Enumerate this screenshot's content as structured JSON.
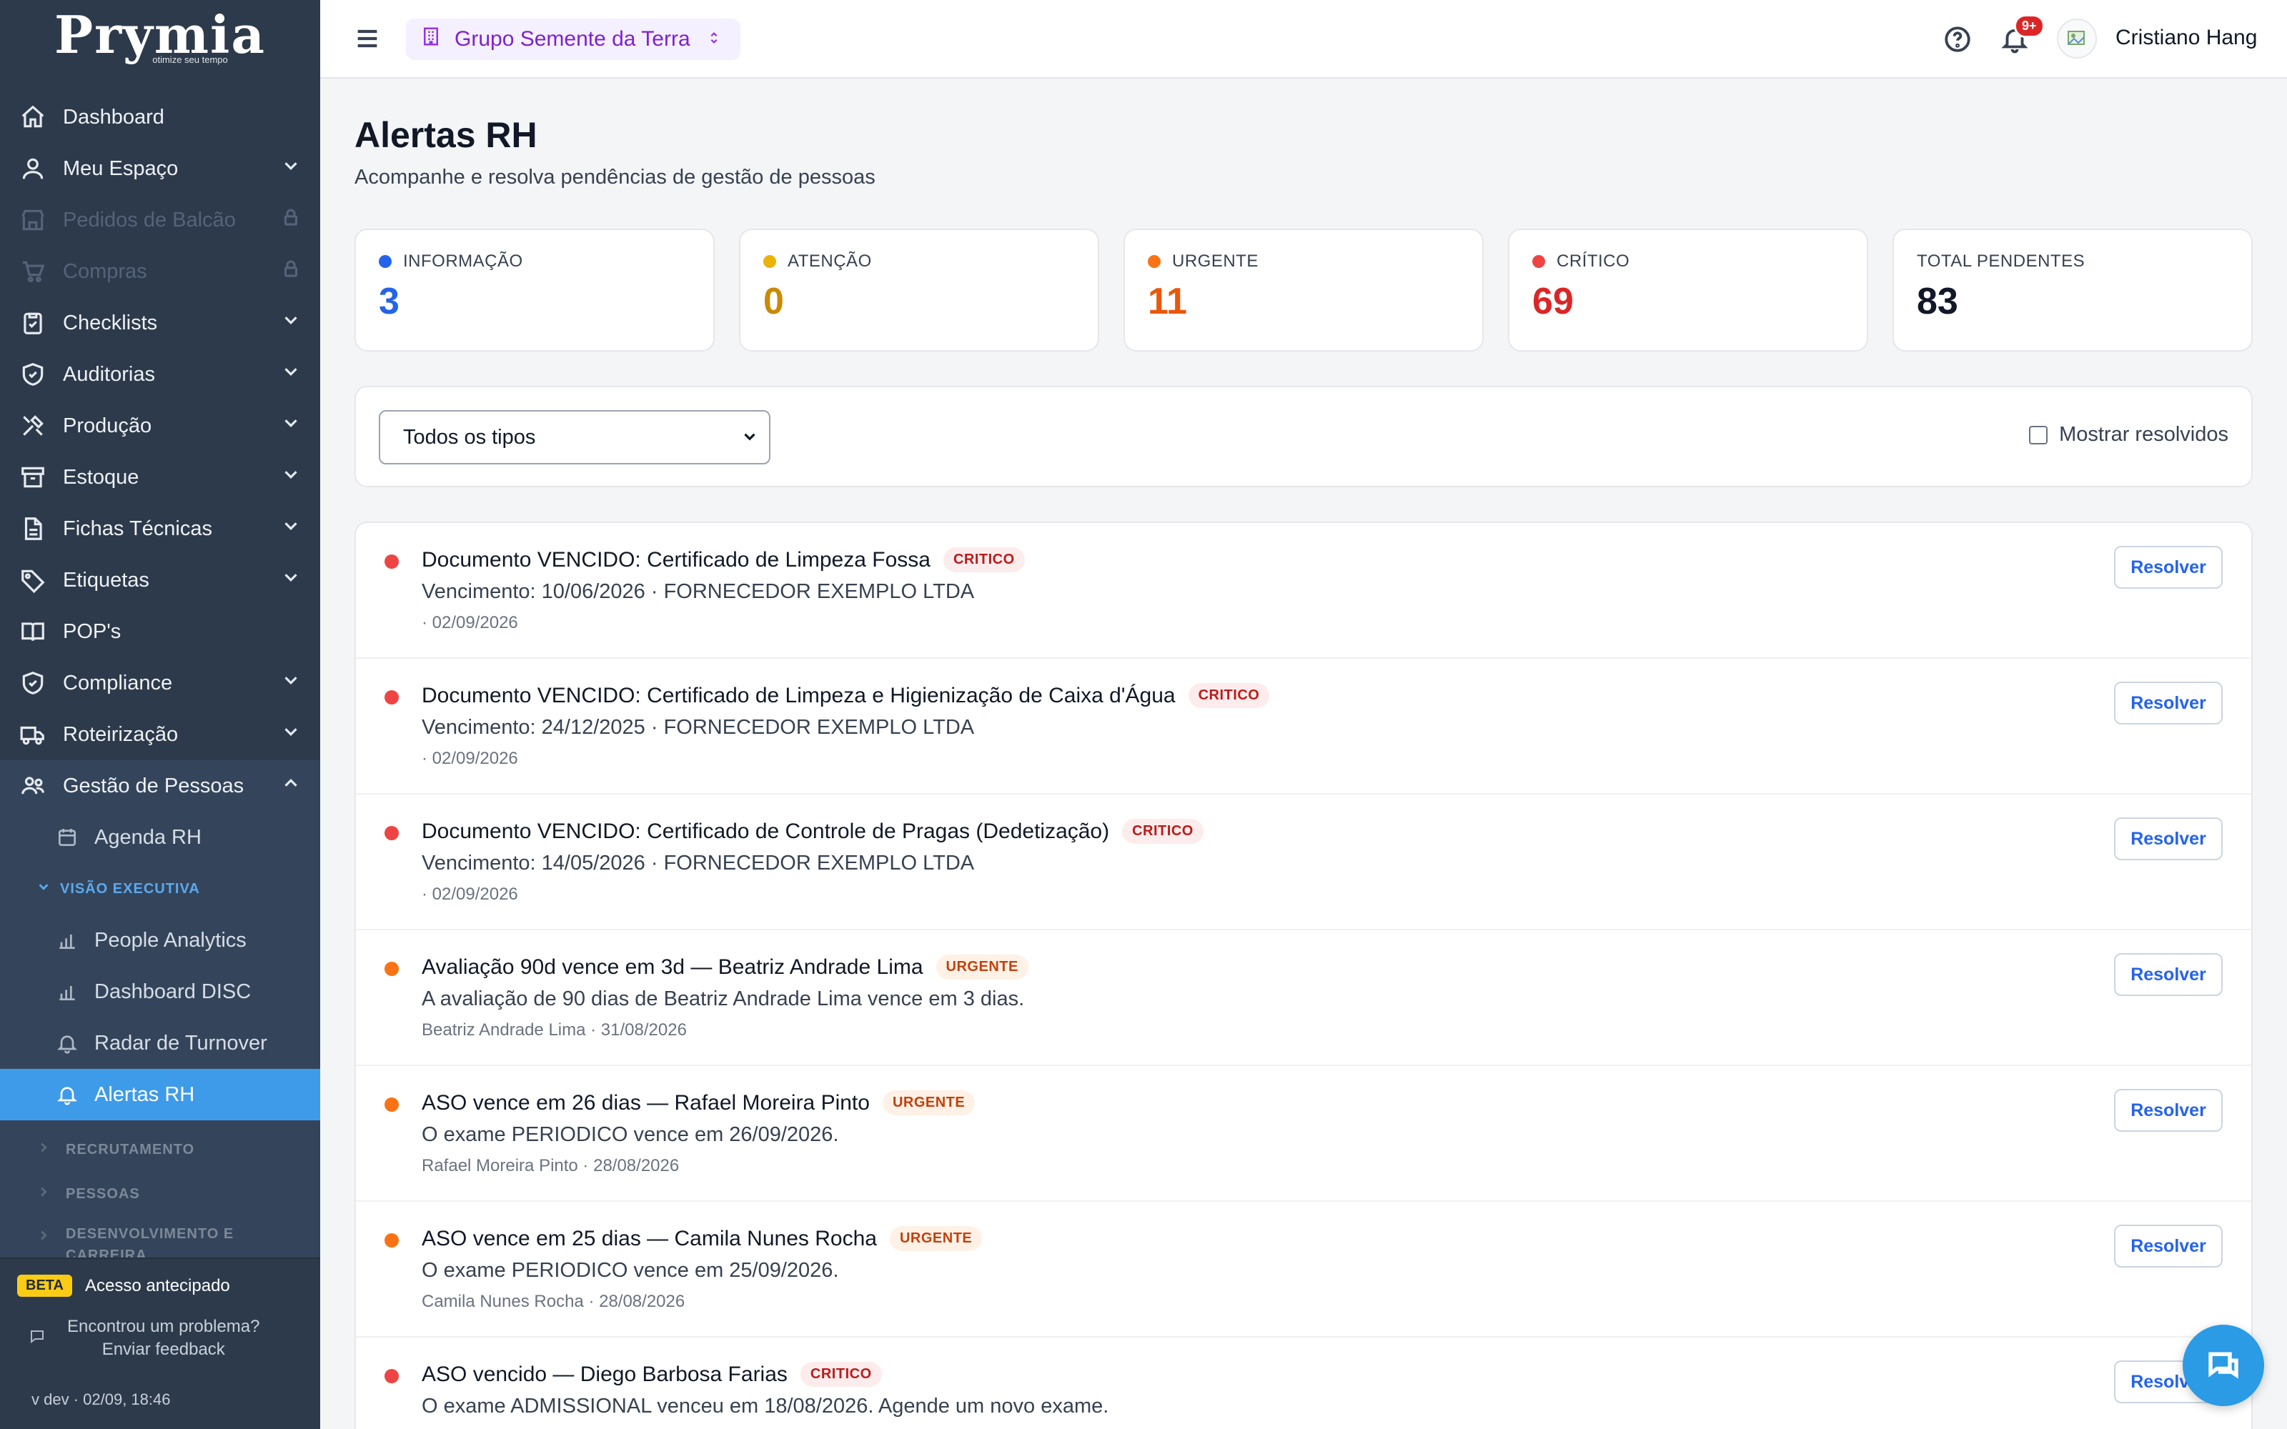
{
  "brand": {
    "logo": "Prymia",
    "tagline": "otimize seu tempo"
  },
  "sidebar": {
    "items": [
      {
        "label": "Dashboard",
        "icon": "home-icon"
      },
      {
        "label": "Meu Espaço",
        "icon": "user-icon"
      },
      {
        "label": "Pedidos de Balcão",
        "icon": "store-icon"
      },
      {
        "label": "Compras",
        "icon": "cart-icon"
      },
      {
        "label": "Checklists",
        "icon": "clipboard-icon"
      },
      {
        "label": "Auditorias",
        "icon": "shield-check-icon"
      },
      {
        "label": "Produção",
        "icon": "tools-icon"
      },
      {
        "label": "Estoque",
        "icon": "archive-icon"
      },
      {
        "label": "Fichas Técnicas",
        "icon": "file-icon"
      },
      {
        "label": "Etiquetas",
        "icon": "tag-icon"
      },
      {
        "label": "POP's",
        "icon": "book-icon"
      },
      {
        "label": "Compliance",
        "icon": "shield-check-icon"
      },
      {
        "label": "Roteirização",
        "icon": "truck-icon"
      },
      {
        "label": "Gestão de Pessoas",
        "icon": "users-icon"
      }
    ],
    "sub": {
      "agenda": "Agenda RH",
      "visao_executiva": "VISÃO EXECUTIVA",
      "people_analytics": "People Analytics",
      "dashboard_disc": "Dashboard DISC",
      "radar_turnover": "Radar de Turnover",
      "alertas_rh": "Alertas RH",
      "recrutamento": "RECRUTAMENTO",
      "pessoas": "PESSOAS",
      "desenvolvimento_1": "DESENVOLVIMENTO E",
      "desenvolvimento_2": "CARREIRA"
    },
    "footer": {
      "beta_badge": "BETA",
      "beta_text": "Acesso antecipado",
      "feedback_1": "Encontrou um problema?",
      "feedback_2": "Enviar feedback",
      "version": "v dev · 02/09, 18:46"
    }
  },
  "topbar": {
    "org": "Grupo Semente da Terra",
    "notifications_badge": "9+",
    "user_name": "Cristiano Hang"
  },
  "page": {
    "title": "Alertas RH",
    "subtitle": "Acompanhe e resolva pendências de gestão de pessoas"
  },
  "stats": [
    {
      "label": "INFORMAÇÃO",
      "value": "3",
      "color": "#2563eb"
    },
    {
      "label": "ATENÇÃO",
      "value": "0",
      "color": "#ca8a04"
    },
    {
      "label": "URGENTE",
      "value": "11",
      "color": "#ea580c"
    },
    {
      "label": "CRÍTICO",
      "value": "69",
      "color": "#dc2626"
    },
    {
      "label": "TOTAL PENDENTES",
      "value": "83",
      "color": "#111827"
    }
  ],
  "filters": {
    "type_select": "Todos os tipos",
    "show_resolved": "Mostrar resolvidos"
  },
  "alerts": [
    {
      "title": "Documento VENCIDO: Certificado de Limpeza Fossa",
      "severity": "CRITICO",
      "level": "critico",
      "desc": "Vencimento: 10/06/2026 · FORNECEDOR EXEMPLO LTDA",
      "meta": "· 02/09/2026",
      "action": "Resolver"
    },
    {
      "title": "Documento VENCIDO: Certificado de Limpeza e Higienização de Caixa d'Água",
      "severity": "CRITICO",
      "level": "critico",
      "desc": "Vencimento: 24/12/2025 · FORNECEDOR EXEMPLO LTDA",
      "meta": "· 02/09/2026",
      "action": "Resolver"
    },
    {
      "title": "Documento VENCIDO: Certificado de Controle de Pragas (Dedetização)",
      "severity": "CRITICO",
      "level": "critico",
      "desc": "Vencimento: 14/05/2026 · FORNECEDOR EXEMPLO LTDA",
      "meta": "· 02/09/2026",
      "action": "Resolver"
    },
    {
      "title": "Avaliação 90d vence em 3d — Beatriz Andrade Lima",
      "severity": "URGENTE",
      "level": "urgente",
      "desc": "A avaliação de 90 dias de Beatriz Andrade Lima vence em 3 dias.",
      "meta": "Beatriz Andrade Lima · 31/08/2026",
      "action": "Resolver"
    },
    {
      "title": "ASO vence em 26 dias — Rafael Moreira Pinto",
      "severity": "URGENTE",
      "level": "urgente",
      "desc": "O exame PERIODICO vence em 26/09/2026.",
      "meta": "Rafael Moreira Pinto · 28/08/2026",
      "action": "Resolver"
    },
    {
      "title": "ASO vence em 25 dias — Camila Nunes Rocha",
      "severity": "URGENTE",
      "level": "urgente",
      "desc": "O exame PERIODICO vence em 25/09/2026.",
      "meta": "Camila Nunes Rocha · 28/08/2026",
      "action": "Resolver"
    },
    {
      "title": "ASO vencido — Diego Barbosa Farias",
      "severity": "CRITICO",
      "level": "critico",
      "desc": "O exame ADMISSIONAL venceu em 18/08/2026. Agende um novo exame.",
      "meta": "",
      "action": "Resolver"
    }
  ],
  "colors": {
    "critico": "#ef4444",
    "urgente": "#f97316",
    "accent": "#3d9be9",
    "sidebar": "#2d3a4b"
  }
}
